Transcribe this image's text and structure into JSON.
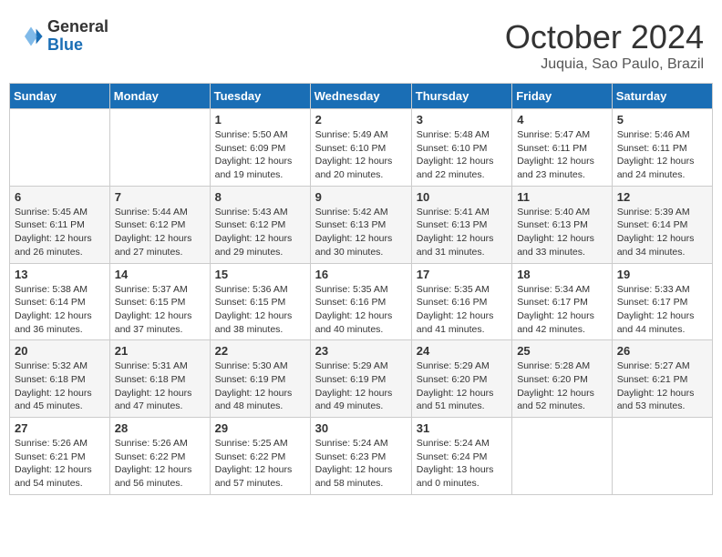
{
  "logo": {
    "general": "General",
    "blue": "Blue"
  },
  "header": {
    "month": "October 2024",
    "location": "Juquia, Sao Paulo, Brazil"
  },
  "days_of_week": [
    "Sunday",
    "Monday",
    "Tuesday",
    "Wednesday",
    "Thursday",
    "Friday",
    "Saturday"
  ],
  "weeks": [
    [
      null,
      null,
      {
        "day": 1,
        "sunrise": "5:50 AM",
        "sunset": "6:09 PM",
        "daylight": "12 hours and 19 minutes."
      },
      {
        "day": 2,
        "sunrise": "5:49 AM",
        "sunset": "6:10 PM",
        "daylight": "12 hours and 20 minutes."
      },
      {
        "day": 3,
        "sunrise": "5:48 AM",
        "sunset": "6:10 PM",
        "daylight": "12 hours and 22 minutes."
      },
      {
        "day": 4,
        "sunrise": "5:47 AM",
        "sunset": "6:11 PM",
        "daylight": "12 hours and 23 minutes."
      },
      {
        "day": 5,
        "sunrise": "5:46 AM",
        "sunset": "6:11 PM",
        "daylight": "12 hours and 24 minutes."
      }
    ],
    [
      {
        "day": 6,
        "sunrise": "5:45 AM",
        "sunset": "6:11 PM",
        "daylight": "12 hours and 26 minutes."
      },
      {
        "day": 7,
        "sunrise": "5:44 AM",
        "sunset": "6:12 PM",
        "daylight": "12 hours and 27 minutes."
      },
      {
        "day": 8,
        "sunrise": "5:43 AM",
        "sunset": "6:12 PM",
        "daylight": "12 hours and 29 minutes."
      },
      {
        "day": 9,
        "sunrise": "5:42 AM",
        "sunset": "6:13 PM",
        "daylight": "12 hours and 30 minutes."
      },
      {
        "day": 10,
        "sunrise": "5:41 AM",
        "sunset": "6:13 PM",
        "daylight": "12 hours and 31 minutes."
      },
      {
        "day": 11,
        "sunrise": "5:40 AM",
        "sunset": "6:13 PM",
        "daylight": "12 hours and 33 minutes."
      },
      {
        "day": 12,
        "sunrise": "5:39 AM",
        "sunset": "6:14 PM",
        "daylight": "12 hours and 34 minutes."
      }
    ],
    [
      {
        "day": 13,
        "sunrise": "5:38 AM",
        "sunset": "6:14 PM",
        "daylight": "12 hours and 36 minutes."
      },
      {
        "day": 14,
        "sunrise": "5:37 AM",
        "sunset": "6:15 PM",
        "daylight": "12 hours and 37 minutes."
      },
      {
        "day": 15,
        "sunrise": "5:36 AM",
        "sunset": "6:15 PM",
        "daylight": "12 hours and 38 minutes."
      },
      {
        "day": 16,
        "sunrise": "5:35 AM",
        "sunset": "6:16 PM",
        "daylight": "12 hours and 40 minutes."
      },
      {
        "day": 17,
        "sunrise": "5:35 AM",
        "sunset": "6:16 PM",
        "daylight": "12 hours and 41 minutes."
      },
      {
        "day": 18,
        "sunrise": "5:34 AM",
        "sunset": "6:17 PM",
        "daylight": "12 hours and 42 minutes."
      },
      {
        "day": 19,
        "sunrise": "5:33 AM",
        "sunset": "6:17 PM",
        "daylight": "12 hours and 44 minutes."
      }
    ],
    [
      {
        "day": 20,
        "sunrise": "5:32 AM",
        "sunset": "6:18 PM",
        "daylight": "12 hours and 45 minutes."
      },
      {
        "day": 21,
        "sunrise": "5:31 AM",
        "sunset": "6:18 PM",
        "daylight": "12 hours and 47 minutes."
      },
      {
        "day": 22,
        "sunrise": "5:30 AM",
        "sunset": "6:19 PM",
        "daylight": "12 hours and 48 minutes."
      },
      {
        "day": 23,
        "sunrise": "5:29 AM",
        "sunset": "6:19 PM",
        "daylight": "12 hours and 49 minutes."
      },
      {
        "day": 24,
        "sunrise": "5:29 AM",
        "sunset": "6:20 PM",
        "daylight": "12 hours and 51 minutes."
      },
      {
        "day": 25,
        "sunrise": "5:28 AM",
        "sunset": "6:20 PM",
        "daylight": "12 hours and 52 minutes."
      },
      {
        "day": 26,
        "sunrise": "5:27 AM",
        "sunset": "6:21 PM",
        "daylight": "12 hours and 53 minutes."
      }
    ],
    [
      {
        "day": 27,
        "sunrise": "5:26 AM",
        "sunset": "6:21 PM",
        "daylight": "12 hours and 54 minutes."
      },
      {
        "day": 28,
        "sunrise": "5:26 AM",
        "sunset": "6:22 PM",
        "daylight": "12 hours and 56 minutes."
      },
      {
        "day": 29,
        "sunrise": "5:25 AM",
        "sunset": "6:22 PM",
        "daylight": "12 hours and 57 minutes."
      },
      {
        "day": 30,
        "sunrise": "5:24 AM",
        "sunset": "6:23 PM",
        "daylight": "12 hours and 58 minutes."
      },
      {
        "day": 31,
        "sunrise": "5:24 AM",
        "sunset": "6:24 PM",
        "daylight": "13 hours and 0 minutes."
      },
      null,
      null
    ]
  ]
}
